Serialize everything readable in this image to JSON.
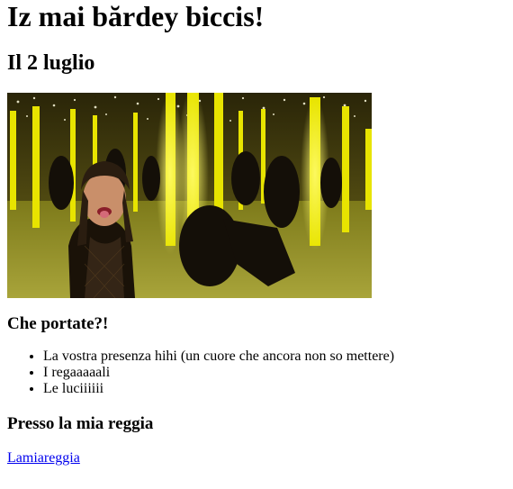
{
  "page": {
    "title": "Iz mai bărdey biccis!",
    "date_heading": "Il 2 luglio",
    "bring_heading": "Che portate?!",
    "bring_items": [
      "La vostra presenza hihi (un cuore che ancora non so mettere)",
      "I regaaaaali",
      "Le luciiiiii"
    ],
    "location_heading": "Presso la mia reggia",
    "location_link": "Lamiareggia"
  },
  "image": {
    "subject": "photo-dancers-yellow-neon-mirror-room"
  },
  "colors": {
    "link": "#0000ee",
    "neon": "#f4f000"
  }
}
